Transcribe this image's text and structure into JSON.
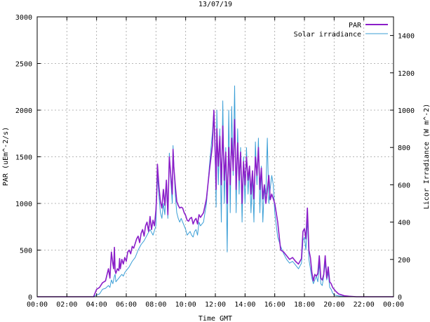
{
  "chart_data": {
    "type": "line",
    "title": "13/07/19",
    "xlabel": "Time GMT",
    "ylabel": "PAR (uEm^-2/s)",
    "y2label": "Licor Irradiance (W m^-2)",
    "xlim": [
      0,
      24
    ],
    "ylim": [
      0,
      3000
    ],
    "y2lim": [
      0,
      1500
    ],
    "x_ticks": [
      0,
      2,
      4,
      6,
      8,
      10,
      12,
      14,
      16,
      18,
      20,
      22,
      24
    ],
    "x_tick_labels": [
      "00:00",
      "02:00",
      "04:00",
      "06:00",
      "08:00",
      "10:00",
      "12:00",
      "14:00",
      "16:00",
      "18:00",
      "20:00",
      "22:00",
      "00:00"
    ],
    "y_ticks": [
      0,
      500,
      1000,
      1500,
      2000,
      2500,
      3000
    ],
    "y_tick_labels": [
      "0",
      "500",
      "1000",
      "1500",
      "2000",
      "2500",
      "3000"
    ],
    "y2_ticks": [
      0,
      200,
      400,
      600,
      800,
      1000,
      1200,
      1400
    ],
    "y2_tick_labels": [
      "0",
      "200",
      "400",
      "600",
      "800",
      "1000",
      "1200",
      "1400"
    ],
    "grid": true,
    "legend_position": "top-right",
    "series": [
      {
        "name": "PAR",
        "axis": "left",
        "color": "#8a1ec8",
        "x": [
          0,
          3.8,
          4.0,
          4.2,
          4.4,
          4.6,
          4.8,
          4.9,
          5.0,
          5.1,
          5.15,
          5.2,
          5.25,
          5.3,
          5.4,
          5.5,
          5.55,
          5.6,
          5.7,
          5.8,
          5.9,
          6.0,
          6.1,
          6.2,
          6.3,
          6.4,
          6.5,
          6.6,
          6.7,
          6.8,
          6.9,
          7.0,
          7.1,
          7.2,
          7.3,
          7.4,
          7.5,
          7.6,
          7.7,
          7.8,
          7.9,
          8.0,
          8.05,
          8.1,
          8.2,
          8.3,
          8.4,
          8.5,
          8.6,
          8.7,
          8.8,
          8.9,
          9.0,
          9.1,
          9.15,
          9.2,
          9.3,
          9.4,
          9.5,
          9.6,
          9.7,
          9.8,
          9.9,
          10.0,
          10.1,
          10.2,
          10.3,
          10.4,
          10.5,
          10.6,
          10.7,
          10.8,
          10.9,
          11.0,
          11.2,
          11.4,
          11.6,
          11.8,
          11.9,
          12.0,
          12.05,
          12.1,
          12.2,
          12.3,
          12.4,
          12.5,
          12.6,
          12.7,
          12.8,
          12.9,
          13.0,
          13.1,
          13.2,
          13.3,
          13.4,
          13.5,
          13.6,
          13.7,
          13.8,
          13.9,
          14.0,
          14.1,
          14.2,
          14.3,
          14.4,
          14.5,
          14.6,
          14.7,
          14.8,
          14.9,
          15.0,
          15.1,
          15.2,
          15.3,
          15.4,
          15.5,
          15.6,
          15.7,
          15.8,
          15.9,
          16.0,
          16.2,
          16.4,
          16.6,
          16.8,
          17.0,
          17.2,
          17.4,
          17.6,
          17.8,
          17.9,
          18.0,
          18.1,
          18.2,
          18.3,
          18.4,
          18.5,
          18.6,
          18.7,
          18.8,
          18.9,
          19.0,
          19.1,
          19.2,
          19.3,
          19.4,
          19.5,
          19.6,
          19.7,
          19.8,
          19.9,
          20.0,
          20.1,
          20.3,
          20.5,
          20.7,
          21.0,
          21.5,
          24
        ],
        "y": [
          0,
          0,
          80,
          100,
          150,
          170,
          300,
          200,
          480,
          350,
          300,
          530,
          280,
          250,
          300,
          280,
          410,
          300,
          400,
          350,
          420,
          380,
          480,
          500,
          460,
          540,
          520,
          570,
          620,
          650,
          580,
          680,
          720,
          650,
          760,
          800,
          700,
          860,
          720,
          820,
          760,
          930,
          1100,
          1420,
          1180,
          1020,
          950,
          1150,
          980,
          1250,
          880,
          1500,
          1300,
          1100,
          1580,
          1400,
          1200,
          1020,
          980,
          950,
          960,
          950,
          900,
          870,
          820,
          810,
          840,
          850,
          780,
          820,
          840,
          780,
          880,
          850,
          900,
          1050,
          1350,
          1620,
          2000,
          1500,
          1150,
          1800,
          1400,
          1720,
          1200,
          1830,
          1250,
          1550,
          1000,
          1600,
          1200,
          1700,
          1350,
          1900,
          1150,
          1650,
          1250,
          1550,
          1000,
          1450,
          1200,
          1500,
          1250,
          1400,
          1100,
          1350,
          1050,
          1500,
          1300,
          1600,
          1150,
          1380,
          1050,
          1200,
          1000,
          1150,
          1300,
          1040,
          1100,
          1050,
          1000,
          800,
          500,
          480,
          440,
          400,
          420,
          380,
          350,
          410,
          700,
          730,
          620,
          950,
          500,
          420,
          260,
          170,
          240,
          220,
          250,
          440,
          200,
          180,
          240,
          440,
          200,
          320,
          160,
          140,
          100,
          80,
          60,
          30,
          20,
          10,
          5,
          0,
          0
        ]
      },
      {
        "name": "Solar irradiance",
        "axis": "right",
        "color": "#3a9ed6",
        "x": [
          0,
          3.8,
          4.0,
          4.2,
          4.4,
          4.6,
          4.8,
          4.9,
          5.0,
          5.1,
          5.2,
          5.25,
          5.3,
          5.4,
          5.5,
          5.6,
          5.7,
          5.8,
          5.9,
          6.0,
          6.2,
          6.4,
          6.6,
          6.8,
          7.0,
          7.2,
          7.4,
          7.6,
          7.8,
          8.0,
          8.05,
          8.1,
          8.2,
          8.3,
          8.4,
          8.5,
          8.6,
          8.7,
          8.8,
          8.9,
          9.0,
          9.1,
          9.15,
          9.2,
          9.3,
          9.4,
          9.5,
          9.6,
          9.7,
          9.8,
          9.9,
          10.0,
          10.1,
          10.2,
          10.3,
          10.4,
          10.5,
          10.6,
          10.7,
          10.8,
          10.9,
          11.0,
          11.2,
          11.4,
          11.6,
          11.8,
          11.9,
          12.0,
          12.05,
          12.1,
          12.2,
          12.3,
          12.4,
          12.5,
          12.6,
          12.7,
          12.8,
          12.9,
          13.0,
          13.1,
          13.2,
          13.3,
          13.4,
          13.5,
          13.6,
          13.7,
          13.8,
          13.9,
          14.0,
          14.1,
          14.2,
          14.3,
          14.4,
          14.5,
          14.6,
          14.7,
          14.8,
          14.9,
          15.0,
          15.1,
          15.2,
          15.3,
          15.4,
          15.5,
          15.6,
          15.7,
          15.8,
          15.9,
          16.0,
          16.2,
          16.4,
          16.6,
          16.8,
          17.0,
          17.2,
          17.4,
          17.6,
          17.8,
          17.9,
          18.0,
          18.1,
          18.2,
          18.3,
          18.4,
          18.5,
          18.6,
          18.7,
          18.8,
          18.9,
          19.0,
          19.1,
          19.2,
          19.3,
          19.4,
          19.5,
          19.6,
          19.7,
          19.8,
          19.9,
          20.0,
          20.1,
          20.3,
          20.5,
          20.7,
          21.0,
          21.5,
          24
        ],
        "y": [
          0,
          0,
          10,
          15,
          40,
          45,
          60,
          50,
          90,
          70,
          110,
          120,
          80,
          90,
          100,
          110,
          120,
          110,
          130,
          140,
          160,
          190,
          210,
          250,
          280,
          300,
          330,
          360,
          330,
          380,
          560,
          650,
          540,
          450,
          420,
          500,
          440,
          620,
          420,
          770,
          620,
          500,
          810,
          720,
          550,
          450,
          420,
          400,
          420,
          400,
          380,
          360,
          330,
          340,
          350,
          330,
          320,
          350,
          360,
          330,
          400,
          380,
          400,
          500,
          700,
          880,
          1000,
          700,
          480,
          1000,
          600,
          900,
          400,
          1050,
          500,
          800,
          240,
          1000,
          450,
          1020,
          650,
          1130,
          450,
          900,
          550,
          800,
          400,
          750,
          500,
          800,
          550,
          700,
          450,
          650,
          400,
          830,
          600,
          850,
          450,
          700,
          400,
          600,
          550,
          850,
          500,
          580,
          650,
          600,
          450,
          320,
          270,
          230,
          200,
          180,
          190,
          170,
          150,
          180,
          300,
          320,
          250,
          420,
          200,
          150,
          100,
          70,
          90,
          110,
          80,
          180,
          70,
          60,
          110,
          180,
          90,
          130,
          50,
          40,
          20,
          10,
          8,
          5,
          3,
          2,
          0,
          0,
          0
        ]
      }
    ]
  }
}
